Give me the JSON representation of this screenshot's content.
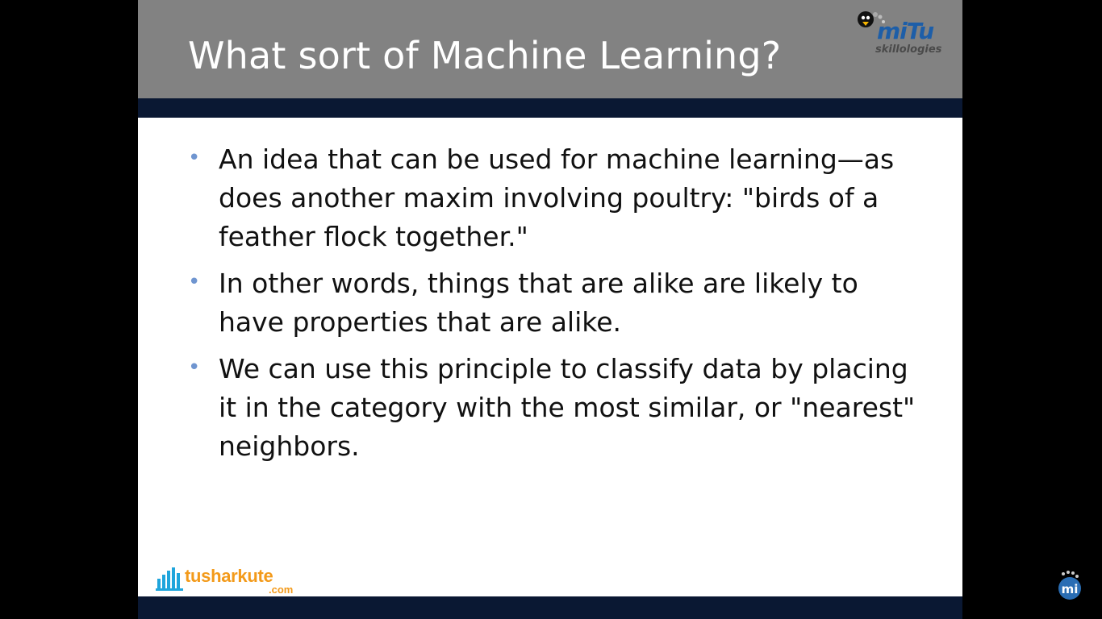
{
  "slide": {
    "title": "What sort of Machine Learning?",
    "bullets": [
      "An idea that can be used for machine learning—as does another maxim involving poultry: \"birds of a feather flock together.\"",
      "In other words, things that are alike are likely to have properties that are alike.",
      "We can use this principle to classify data by placing it in the category with the most similar, or \"nearest\" neighbors."
    ],
    "bullet_symbol": "•"
  },
  "logos": {
    "mitu": {
      "brand": "miTu",
      "tagline": "skillologies"
    },
    "tusharkute": {
      "name": "tusharkute",
      "domain": ".com"
    }
  },
  "colors": {
    "title_bar": "#828282",
    "band": "#0a1833",
    "bullet": "#6f95d0",
    "tk_orange": "#f39a1a",
    "tk_blue": "#1fa5dc",
    "mitu_blue": "#1d5ea8"
  },
  "icons": {
    "penguin": "penguin-icon",
    "bars": "bar-chart-icon",
    "mi_badge": "mi-badge-icon"
  }
}
